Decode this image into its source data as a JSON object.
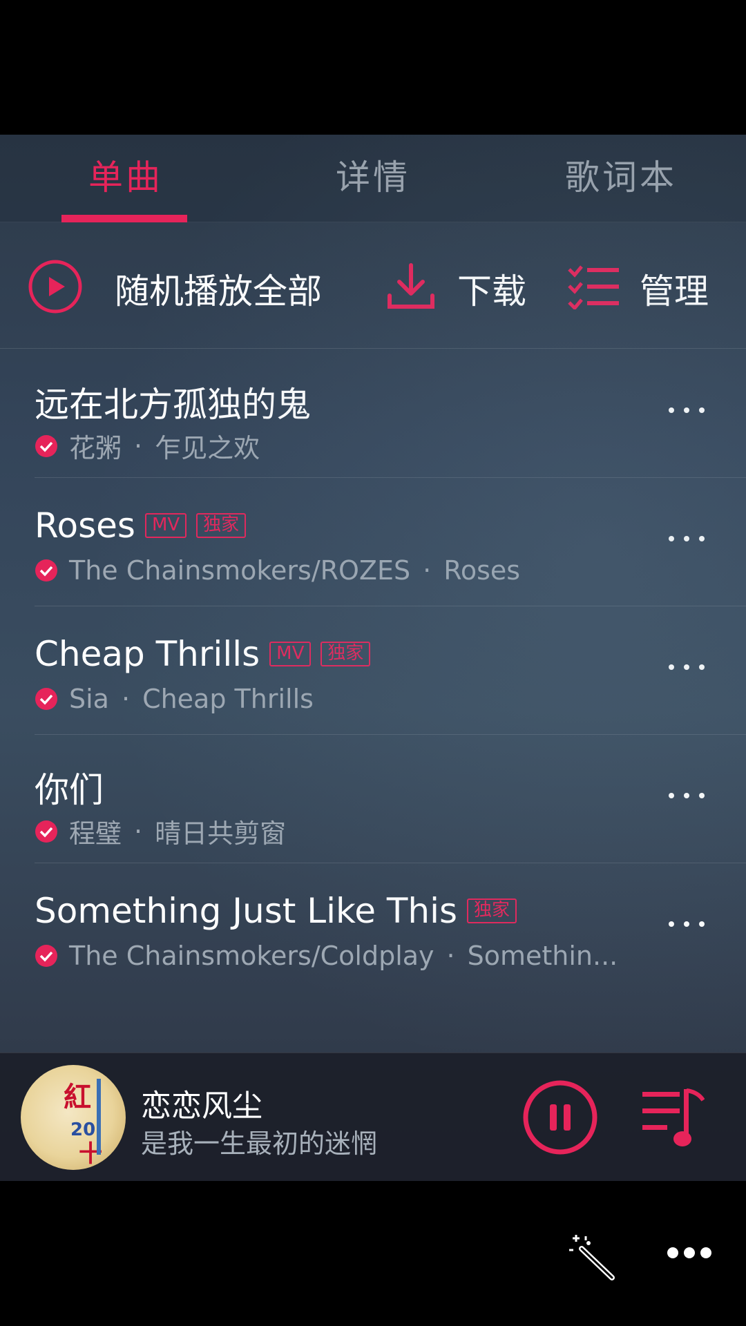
{
  "tabs": [
    {
      "label": "单曲",
      "active": true
    },
    {
      "label": "详情",
      "active": false
    },
    {
      "label": "歌词本",
      "active": false
    }
  ],
  "actions": {
    "shuffle_label": "随机播放全部",
    "download_label": "下载",
    "manage_label": "管理"
  },
  "songs": [
    {
      "title": "远在北方孤独的鬼",
      "tags": [],
      "artist": "花粥",
      "album": "乍见之欢"
    },
    {
      "title": "Roses",
      "tags": [
        "MV",
        "独家"
      ],
      "artist": "The Chainsmokers/ROZES",
      "album": "Roses"
    },
    {
      "title": "Cheap Thrills",
      "tags": [
        "MV",
        "独家"
      ],
      "artist": "Sia",
      "album": "Cheap Thrills"
    },
    {
      "title": "你们",
      "tags": [],
      "artist": "程璧",
      "album": "晴日共剪窗"
    },
    {
      "title": "Something Just Like This",
      "tags": [
        "独家"
      ],
      "artist": "The Chainsmokers/Coldplay",
      "album": "Somethin..."
    }
  ],
  "sub_separator": "·",
  "player": {
    "title": "恋恋风尘",
    "subtitle": "是我一生最初的迷惘",
    "cover_text": "紅二十"
  },
  "colors": {
    "accent": "#e6245a",
    "secondary_text": "#9ea8b3"
  },
  "icons": {
    "shuffle": "play-circle-icon",
    "download": "download-icon",
    "manage": "list-manage-icon",
    "downloaded": "check-circle-icon",
    "more": "more-dots-icon",
    "pause": "pause-circle-icon",
    "queue": "playlist-icon",
    "magic": "magic-wand-icon",
    "overflow": "overflow-dots-icon"
  }
}
